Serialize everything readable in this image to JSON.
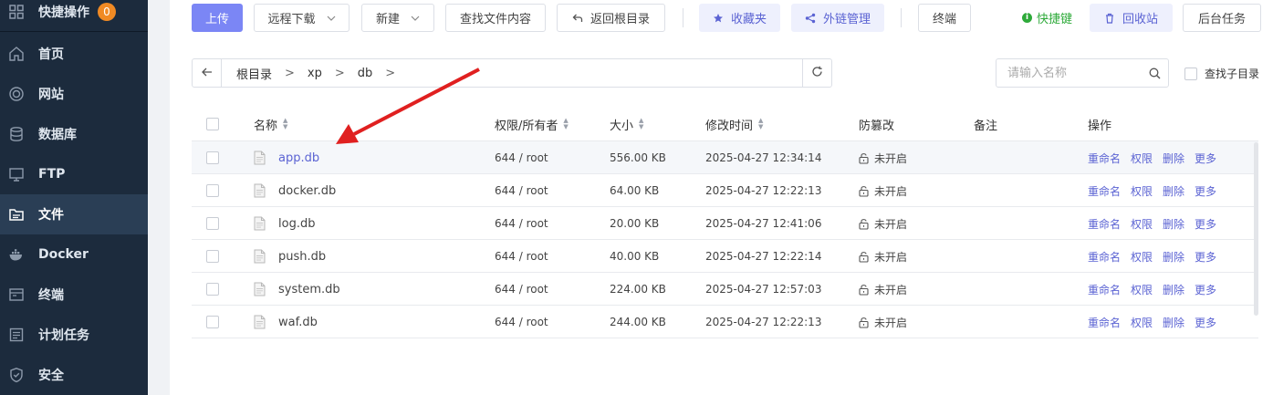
{
  "sidebar": {
    "quick": {
      "label": "快捷操作",
      "badge": "0",
      "icon": "grid-icon"
    },
    "items": [
      {
        "label": "首页",
        "icon": "home-icon",
        "active": false
      },
      {
        "label": "网站",
        "icon": "globe-icon",
        "active": false
      },
      {
        "label": "数据库",
        "icon": "database-icon",
        "active": false
      },
      {
        "label": "FTP",
        "icon": "ftp-icon",
        "active": false
      },
      {
        "label": "文件",
        "icon": "folder-icon",
        "active": true
      },
      {
        "label": "Docker",
        "icon": "docker-icon",
        "active": false
      },
      {
        "label": "终端",
        "icon": "terminal-icon",
        "active": false
      },
      {
        "label": "计划任务",
        "icon": "schedule-icon",
        "active": false
      },
      {
        "label": "安全",
        "icon": "shield-icon",
        "active": false
      }
    ]
  },
  "toolbar": {
    "upload": "上传",
    "remote_download": "远程下载",
    "new": "新建",
    "search_content": "查找文件内容",
    "back_root": "返回根目录",
    "favorites": "收藏夹",
    "share_links": "外链管理",
    "terminal": "终端",
    "shortcut": "快捷键",
    "recycle_bin": "回收站",
    "bg_tasks": "后台任务"
  },
  "breadcrumb": {
    "items": [
      "根目录",
      "xp",
      "db"
    ],
    "separator": ">"
  },
  "search": {
    "placeholder": "请输入名称",
    "value": "",
    "subdir_label": "查找子目录"
  },
  "table": {
    "headers": {
      "name": "名称",
      "perm": "权限/所有者",
      "size": "大小",
      "mtime": "修改时间",
      "protect": "防篡改",
      "note": "备注",
      "ops": "操作"
    },
    "rows": [
      {
        "name": "app.db",
        "perm": "644 / root",
        "size": "556.00 KB",
        "mtime": "2025-04-27 12:34:14",
        "protect": "未开启"
      },
      {
        "name": "docker.db",
        "perm": "644 / root",
        "size": "64.00 KB",
        "mtime": "2025-04-27 12:22:13",
        "protect": "未开启"
      },
      {
        "name": "log.db",
        "perm": "644 / root",
        "size": "20.00 KB",
        "mtime": "2025-04-27 12:41:06",
        "protect": "未开启"
      },
      {
        "name": "push.db",
        "perm": "644 / root",
        "size": "40.00 KB",
        "mtime": "2025-04-27 12:22:14",
        "protect": "未开启"
      },
      {
        "name": "system.db",
        "perm": "644 / root",
        "size": "224.00 KB",
        "mtime": "2025-04-27 12:57:03",
        "protect": "未开启"
      },
      {
        "name": "waf.db",
        "perm": "644 / root",
        "size": "244.00 KB",
        "mtime": "2025-04-27 12:22:13",
        "protect": "未开启"
      }
    ],
    "ops": {
      "rename": "重命名",
      "perm": "权限",
      "delete": "删除",
      "more": "更多"
    }
  },
  "colors": {
    "sidebar_bg": "#1c2b3d",
    "accent": "#7b86f5",
    "link": "#5b63d3",
    "shortcut_green": "#2eaa3a",
    "badge_orange": "#f08a24",
    "arrow_red": "#e02020"
  }
}
